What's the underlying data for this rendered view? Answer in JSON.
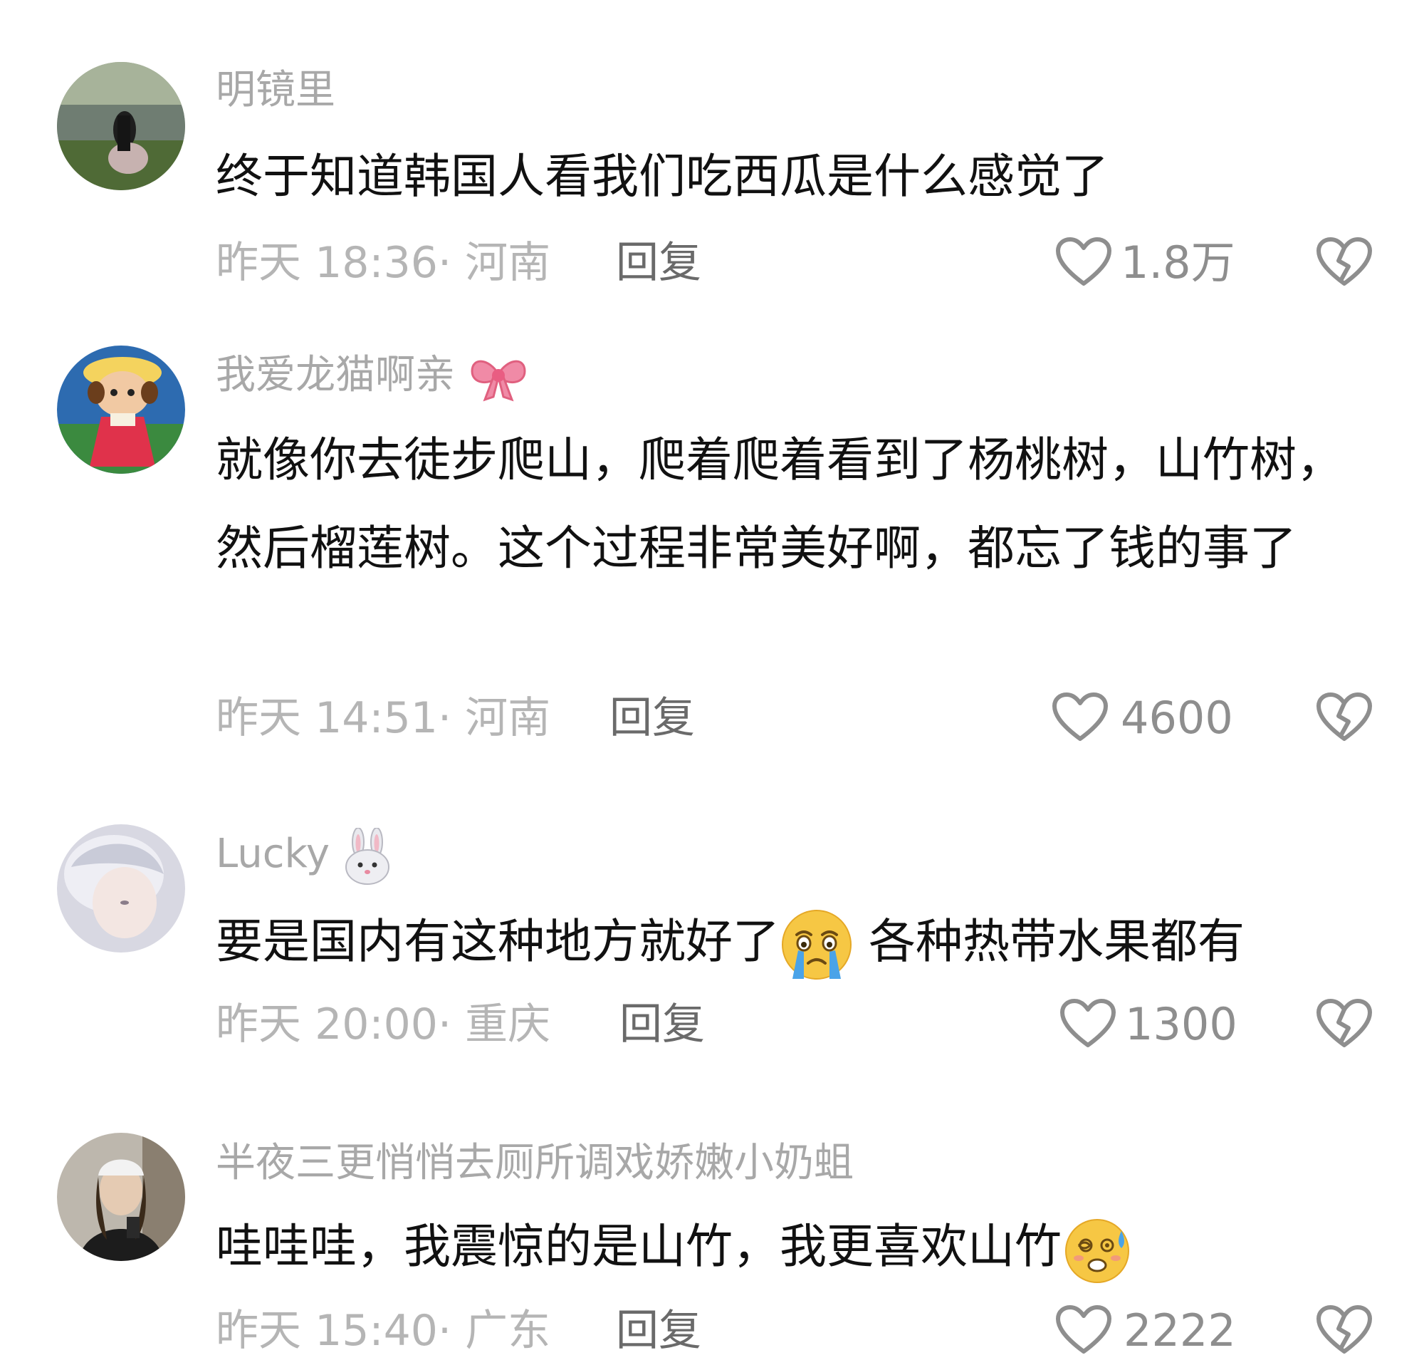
{
  "comments": [
    {
      "username": "明镜里",
      "text": "终于知道韩国人看我们吃西瓜是什么感觉了",
      "time": "昨天 18:36",
      "location": "· 河南",
      "reply_label": "回复",
      "likes": "1.8万"
    },
    {
      "username": "我爱龙猫啊亲",
      "username_emoji": "bow-emoji",
      "text": "就像你去徒步爬山，爬着爬着看到了杨桃树，山竹树，然后榴莲树。这个过程非常美好啊，都忘了钱的事了",
      "time": "昨天 14:51",
      "location": "· 河南",
      "reply_label": "回复",
      "likes": "4600"
    },
    {
      "username": "Lucky",
      "username_emoji": "rabbit-face-emoji",
      "text_part1": "要是国内有这种地方就好了",
      "text_emoji": "crying-face-emoji",
      "text_part2": " 各种热带水果都有",
      "time": "昨天 20:00",
      "location": "· 重庆",
      "reply_label": "回复",
      "likes": "1300"
    },
    {
      "username": "半夜三更悄悄去厕所调戏娇嫩小奶蛆",
      "text_part1": "哇哇哇，我震惊的是山竹，我更喜欢山竹",
      "text_emoji": "dizzy-sweat-face-emoji",
      "time": "昨天 15:40",
      "location": "· 广东",
      "reply_label": "回复",
      "likes": "2222"
    }
  ],
  "colors": {
    "username": "#a8a8a8",
    "content": "#111111",
    "meta": "#b5b5b5",
    "reply": "#6a6a6a",
    "icon": "#8e8e8e"
  }
}
